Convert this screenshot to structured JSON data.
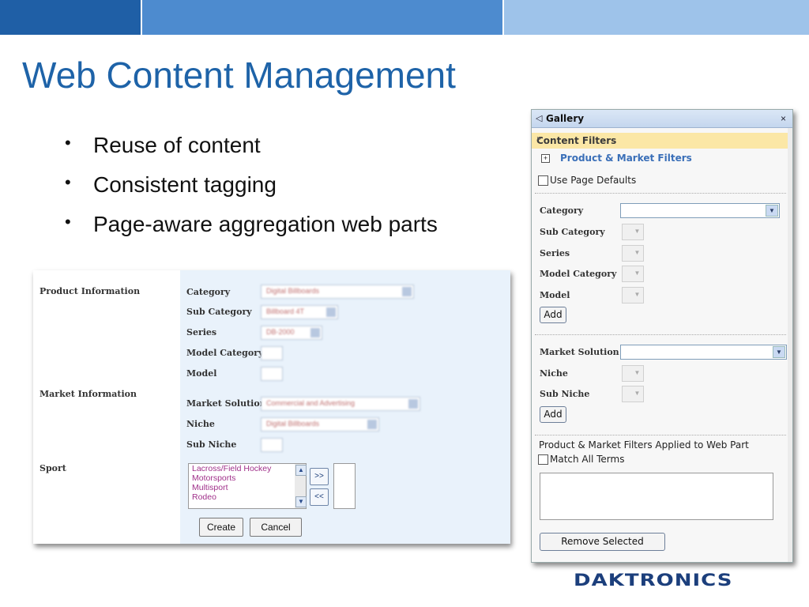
{
  "slide": {
    "title": "Web Content Management",
    "bullets": [
      "Reuse of content",
      "Consistent tagging",
      "Page-aware aggregation web parts"
    ]
  },
  "form": {
    "sections": {
      "product": "Product Information",
      "market": "Market Information",
      "sport": "Sport"
    },
    "fields": {
      "category": "Category",
      "sub_category": "Sub Category",
      "series": "Series",
      "model_category": "Model Category",
      "model": "Model",
      "market_solution": "Market Solution",
      "niche": "Niche",
      "sub_niche": "Sub Niche"
    },
    "sport_options": [
      "Lacross/Field Hockey",
      "Motorsports",
      "Multisport",
      "Rodeo"
    ],
    "move_right": ">>",
    "move_left": "<<",
    "create_label": "Create",
    "cancel_label": "Cancel"
  },
  "gallery": {
    "title": "Gallery",
    "close_symbol": "×",
    "content_filters": "Content Filters",
    "product_market_filters": "Product & Market Filters",
    "use_page_defaults": "Use Page Defaults",
    "labels": {
      "category": "Category",
      "sub_category": "Sub Category",
      "series": "Series",
      "model_category": "Model Category",
      "model": "Model",
      "market_solution": "Market Solution",
      "niche": "Niche",
      "sub_niche": "Sub Niche"
    },
    "add_label": "Add",
    "applied_label": "Product & Market Filters Applied to Web Part",
    "match_all_terms": "Match All Terms",
    "remove_selected": "Remove Selected"
  },
  "brand": {
    "logo_text": "DAKTRONICS"
  },
  "colors": {
    "title_blue": "#1e63a8",
    "banner_dark": "#1f5fa6",
    "filter_header": "#fbe7a6",
    "logo": "#1c3f7c"
  }
}
